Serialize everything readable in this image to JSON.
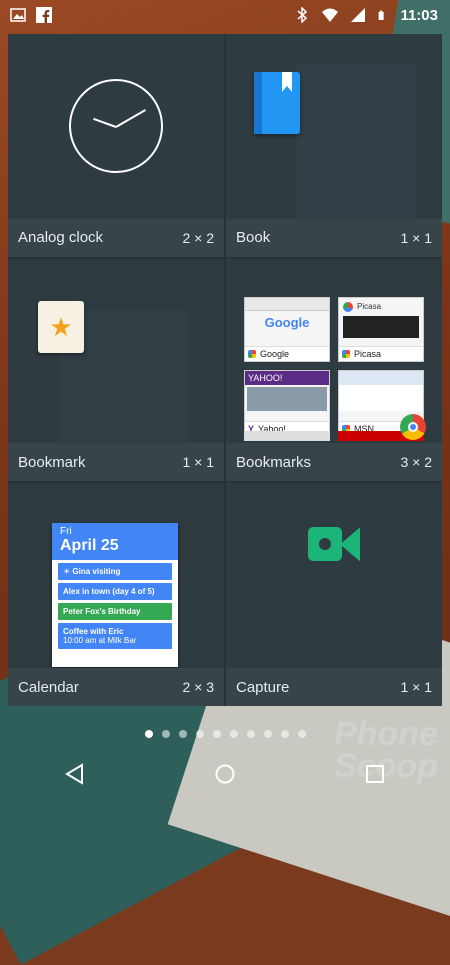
{
  "statusbar": {
    "time": "11:03",
    "left_icons": [
      "image-icon",
      "facebook-icon"
    ],
    "right_icons": [
      "bluetooth-icon",
      "wifi-icon",
      "signal-icon",
      "battery-icon"
    ]
  },
  "widgets": [
    {
      "name": "Analog clock",
      "size": "2 × 2"
    },
    {
      "name": "Book",
      "size": "1 × 1"
    },
    {
      "name": "Bookmark",
      "size": "1 × 1"
    },
    {
      "name": "Bookmarks",
      "size": "3 × 2"
    },
    {
      "name": "Calendar",
      "size": "2 × 3"
    },
    {
      "name": "Capture",
      "size": "1 × 1"
    }
  ],
  "bookmarks_preview": {
    "google_logo": "Google",
    "sites": [
      "Google",
      "Picasa",
      "Yahoo!",
      "MSN"
    ],
    "picasa_logo": "Picasa",
    "yahoo_logo": "YAHOO!"
  },
  "calendar_preview": {
    "day": "Fri",
    "date": "April 25",
    "events": [
      {
        "title": "☀ Gina visiting",
        "color": "blue"
      },
      {
        "title": "Alex in town (day 4 of 5)",
        "color": "blue"
      },
      {
        "title": "Peter Fox's Birthday",
        "color": "green"
      },
      {
        "title": "Coffee with Eric",
        "subtitle": "10:00 am at Milk Bar",
        "color": "blue"
      }
    ]
  },
  "page_indicator": {
    "count": 10,
    "active_index": 0
  },
  "navbar": {
    "buttons": [
      "back",
      "home",
      "recents"
    ]
  },
  "watermark": {
    "line1": "Phone",
    "line2": "Scoop"
  },
  "colors": {
    "panel_bg": "#2e3b40",
    "label_bar_bg": "#374449",
    "accent_blue": "#4285f4",
    "capture_green": "#1db47a"
  }
}
